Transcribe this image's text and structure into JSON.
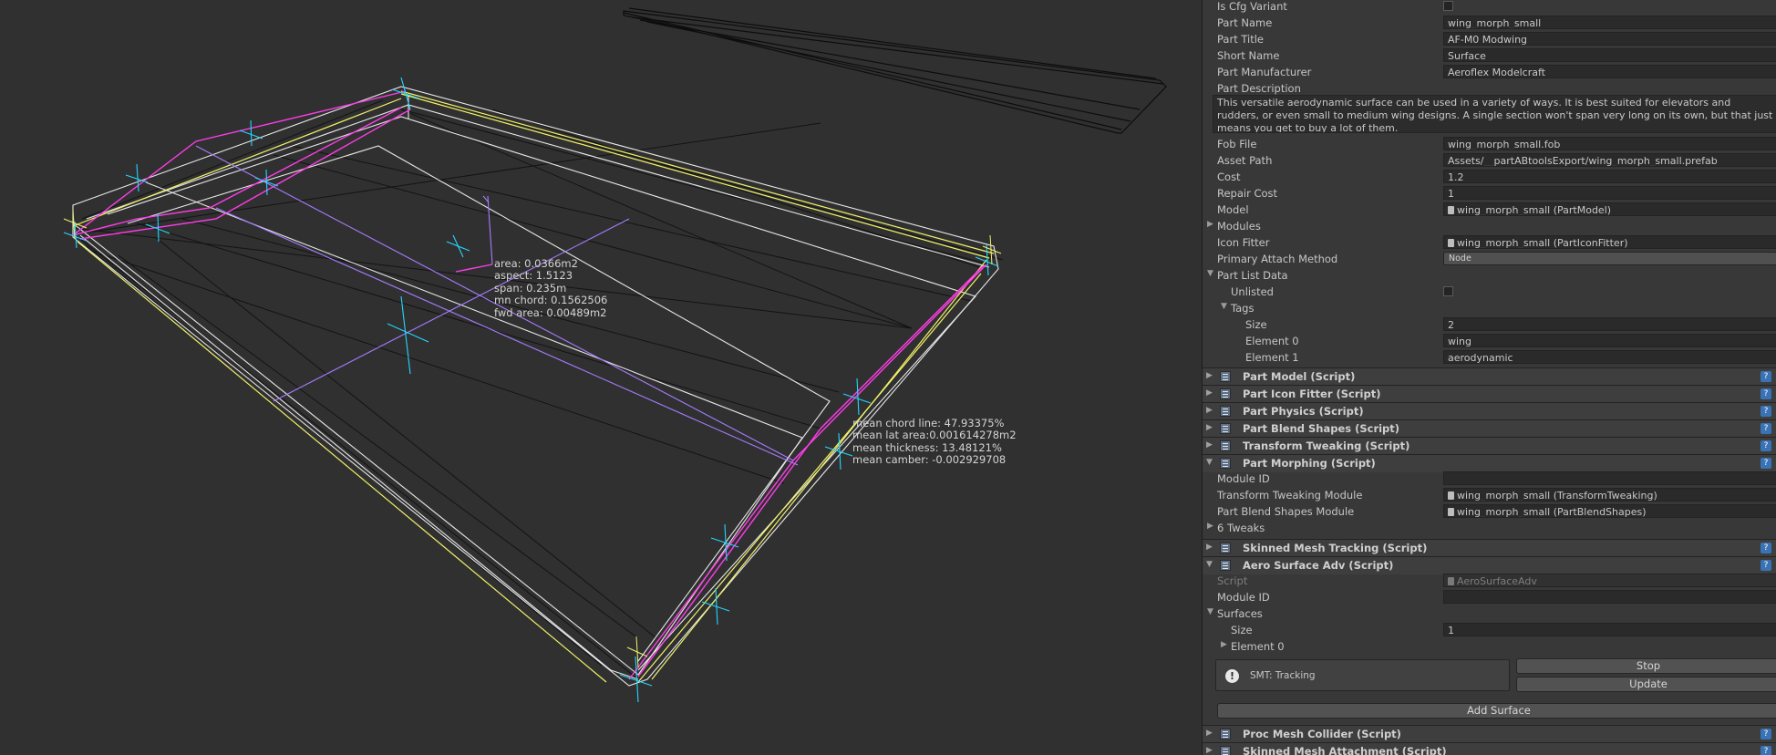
{
  "scene": {
    "stats_center": [
      "area: 0.0366m2",
      "aspect: 1.5123",
      "span: 0.235m",
      "mn chord: 0.1562506",
      "fwd area: 0.00489m2"
    ],
    "stats_tip": [
      "mean chord line: 47.93375%",
      "mean lat area:0.001614278m2",
      "mean thickness: 13.48121%",
      "mean camber: -0.002929708"
    ],
    "line_colors": {
      "white": "#e6e6e6",
      "yellow": "#ffff66",
      "magenta": "#ff3de8",
      "cyan": "#22d8ff",
      "purple": "#a77cff",
      "dark": "#101010"
    }
  },
  "inspector": {
    "fields": {
      "is_cfg_variant": "Is Cfg Variant",
      "part_name_label": "Part Name",
      "part_name": "wing_morph_small",
      "part_title_label": "Part Title",
      "part_title": "AF-M0 Modwing",
      "short_name_label": "Short Name",
      "short_name": "Surface",
      "manufacturer_label": "Part Manufacturer",
      "manufacturer": "Aeroflex Modelcraft",
      "description_label": "Part Description",
      "description_lines": [
        "This versatile aerodynamic surface can be used in a variety of ways. It is best suited for elevators and",
        "rudders, or even small to medium wing designs. A single section won't span very long on its own, but that just",
        "means you get to buy a lot of them."
      ],
      "fob_file_label": "Fob File",
      "fob_file": "wing_morph_small.fob",
      "asset_path_label": "Asset Path",
      "asset_path": "Assets/__partABtoolsExport/wing_morph_small.prefab",
      "cost_label": "Cost",
      "cost": "1.2",
      "repair_cost_label": "Repair Cost",
      "repair_cost": "1",
      "model_label": "Model",
      "model": "wing_morph_small (PartModel)",
      "modules_label": "Modules",
      "icon_fitter_label": "Icon Fitter",
      "icon_fitter": "wing_morph_small (PartIconFitter)",
      "attach_label": "Primary Attach Method",
      "attach_value": "Node",
      "part_list_data_label": "Part List Data",
      "unlisted_label": "Unlisted",
      "tags_label": "Tags",
      "size_label": "Size",
      "size_value": "2",
      "element0_label": "Element 0",
      "element0_value": "wing",
      "element1_label": "Element 1",
      "element1_value": "aerodynamic"
    },
    "components": {
      "part_model": "Part Model (Script)",
      "part_icon_fitter": "Part Icon Fitter (Script)",
      "part_physics": "Part Physics (Script)",
      "part_blend_shapes": "Part Blend Shapes (Script)",
      "transform_tweaking": "Transform Tweaking (Script)",
      "part_morphing": "Part Morphing (Script)",
      "skinned_mesh_tracking": "Skinned Mesh Tracking (Script)",
      "aero_surface_adv": "Aero Surface Adv (Script)",
      "proc_mesh_collider": "Proc Mesh Collider (Script)",
      "skinned_mesh_attachment": "Skinned Mesh Attachment (Script)"
    },
    "morphing": {
      "module_id_label": "Module ID",
      "tt_module_label": "Transform Tweaking Module",
      "tt_module": "wing_morph_small (TransformTweaking)",
      "bs_module_label": "Part Blend Shapes Module",
      "bs_module": "wing_morph_small (PartBlendShapes)",
      "tweaks_label": "6 Tweaks"
    },
    "aero": {
      "script_label": "Script",
      "script_value": "AeroSurfaceAdv",
      "module_id_label": "Module ID",
      "surfaces_label": "Surfaces",
      "size_label": "Size",
      "size_value": "1",
      "element0_label": "Element 0",
      "helpbox_text": "SMT: Tracking",
      "stop_button": "Stop",
      "update_button": "Update",
      "add_surface_button": "Add Surface"
    },
    "help_glyph": "?",
    "warn_glyph": "!",
    "arrow_right": "▶",
    "arrow_down": "▼"
  }
}
